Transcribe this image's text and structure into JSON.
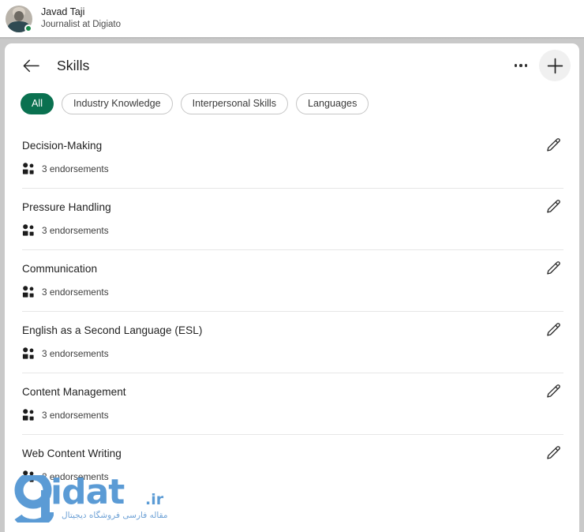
{
  "profile": {
    "name": "Javad Taji",
    "headline": "Journalist at Digiato",
    "avatar_icon": "user-avatar",
    "status_icon": "online-indicator"
  },
  "header": {
    "title": "Skills",
    "back_icon": "arrow-left-icon",
    "more_icon": "more-options-icon",
    "add_icon": "plus-icon"
  },
  "filters": {
    "items": [
      {
        "label": "All",
        "active": true
      },
      {
        "label": "Industry Knowledge",
        "active": false
      },
      {
        "label": "Interpersonal Skills",
        "active": false
      },
      {
        "label": "Languages",
        "active": false
      }
    ]
  },
  "skills": [
    {
      "name": "Decision-Making",
      "endorsements": "3 endorsements",
      "endorse_icon": "people-icon",
      "edit_icon": "pencil-icon"
    },
    {
      "name": "Pressure Handling",
      "endorsements": "3 endorsements",
      "endorse_icon": "people-icon",
      "edit_icon": "pencil-icon"
    },
    {
      "name": "Communication",
      "endorsements": "3 endorsements",
      "endorse_icon": "people-icon",
      "edit_icon": "pencil-icon"
    },
    {
      "name": "English as a Second Language (ESL)",
      "endorsements": "3 endorsements",
      "endorse_icon": "people-icon",
      "edit_icon": "pencil-icon"
    },
    {
      "name": "Content Management",
      "endorsements": "3 endorsements",
      "endorse_icon": "people-icon",
      "edit_icon": "pencil-icon"
    },
    {
      "name": "Web Content Writing",
      "endorsements": "2 endorsements",
      "endorse_icon": "people-icon",
      "edit_icon": "pencil-icon"
    }
  ],
  "watermark": {
    "name": "idat",
    "tld": ".ir",
    "subtitle": "مقاله فارسی فروشگاه دیجیتال",
    "color": "#5b9bd5"
  },
  "colors": {
    "accent_green": "#0a7150",
    "online_green": "#1a8a4b",
    "backdrop": "#c9c9c9",
    "card_bg": "#ffffff",
    "divider": "#e6e6e6"
  }
}
